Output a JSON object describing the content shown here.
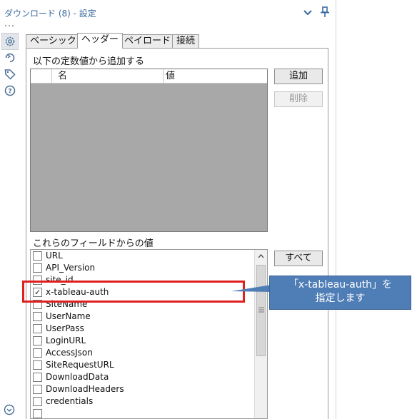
{
  "window": {
    "title": "ダウンロード (8) - 設定",
    "icons": [
      "chevron-down-icon",
      "pin-icon",
      "more-dots-icon"
    ]
  },
  "sidebar": {
    "items": [
      {
        "name": "settings-gear-icon",
        "selected": true
      },
      {
        "name": "refresh-arrow-icon",
        "selected": false
      },
      {
        "name": "tag-icon",
        "selected": false
      },
      {
        "name": "help-icon",
        "selected": false
      }
    ]
  },
  "tabs": [
    {
      "label": "ベーシック",
      "active": false
    },
    {
      "label": "ヘッダー",
      "active": true
    },
    {
      "label": "ペイロード",
      "active": false
    },
    {
      "label": "接続",
      "active": false
    }
  ],
  "constants": {
    "section_label": "以下の定数値から追加する",
    "columns": {
      "name": "名",
      "value": "値"
    },
    "rows": [],
    "add_button": "追加",
    "delete_button": "削除"
  },
  "fields": {
    "section_label": "これらのフィールドからの値",
    "all_button": "すべて",
    "items": [
      {
        "label": "URL",
        "checked": false
      },
      {
        "label": "API_Version",
        "checked": false
      },
      {
        "label": "site_id",
        "checked": false
      },
      {
        "label": "x-tableau-auth",
        "checked": true
      },
      {
        "label": "SiteName",
        "checked": false
      },
      {
        "label": "UserName",
        "checked": false
      },
      {
        "label": "UserPass",
        "checked": false
      },
      {
        "label": "LoginURL",
        "checked": false
      },
      {
        "label": "AccessJson",
        "checked": false
      },
      {
        "label": "SiteRequestURL",
        "checked": false
      },
      {
        "label": "DownloadData",
        "checked": false
      },
      {
        "label": "DownloadHeaders",
        "checked": false
      },
      {
        "label": "credentials",
        "checked": false
      }
    ]
  },
  "annotation": {
    "line1": "「x-tableau-auth」を",
    "line2": "指定します",
    "color": "#4f7db6",
    "highlight_color": "#e01f1f"
  }
}
